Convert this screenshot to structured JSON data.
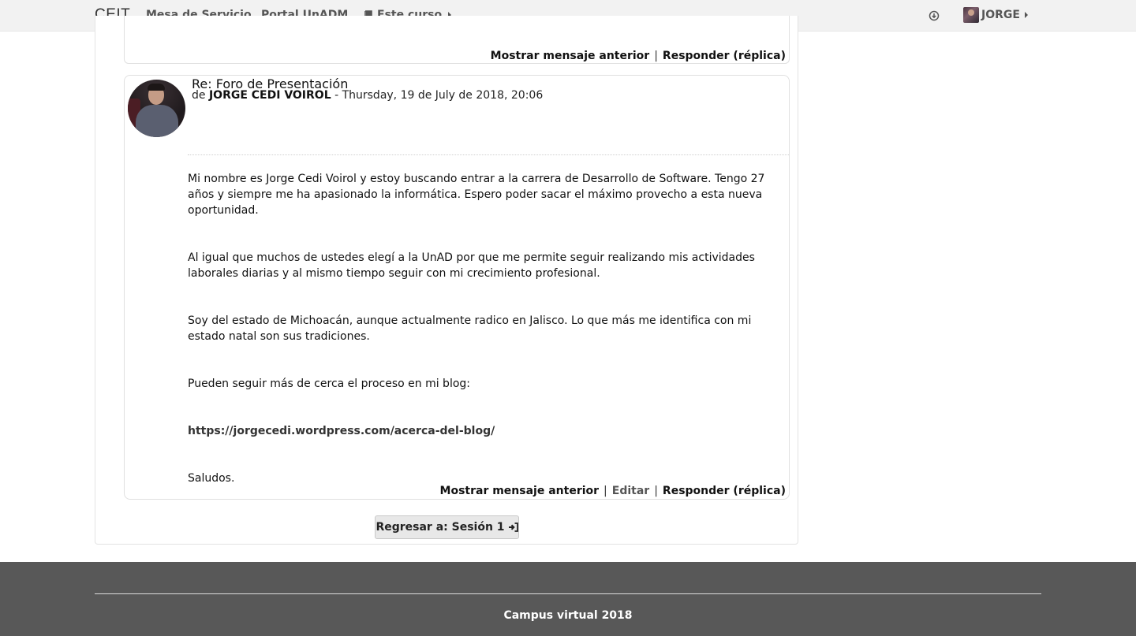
{
  "navbar": {
    "brand": "CEIT",
    "links": {
      "mesa": "Mesa de Servicio",
      "portal": "Portal UnADM",
      "curso": "Este curso"
    },
    "user_name": "JORGE"
  },
  "previous_post": {
    "commands": {
      "show_parent": "Mostrar mensaje anterior",
      "separator": "|",
      "reply": "Responder (réplica)"
    }
  },
  "post": {
    "subject": "Re: Foro de Presentación",
    "author_prefix": "de",
    "author_name": "JORGE CEDI VOIROL",
    "date": "- Thursday, 19 de July de 2018, 20:06",
    "paragraphs": [
      "Mi nombre es Jorge Cedi Voirol y estoy buscando entrar a la carrera de Desarrollo de Software. Tengo 27 años y siempre me ha apasionado la informática. Espero poder sacar el máximo provecho a esta nueva oportunidad.",
      "Al igual que muchos de ustedes elegí a la UnAD por que me permite seguir realizando mis actividades laborales diarias y al mismo tiempo seguir con mi crecimiento profesional.",
      "Soy del estado de Michoacán, aunque actualmente radico en Jalisco. Lo que más me identifica con mi estado natal son sus tradiciones.",
      "Pueden seguir más de cerca el proceso en mi blog:"
    ],
    "blog_link": "https://jorgecedi.wordpress.com/acerca-del-blog/",
    "closing": "Saludos.",
    "commands": {
      "show_parent": "Mostrar mensaje anterior",
      "separator": "|",
      "edit": "Editar",
      "reply": "Responder (réplica)"
    }
  },
  "back_button": {
    "label": "Regresar a: Sesión 1"
  },
  "footer": {
    "text": "Campus virtual 2018"
  },
  "icons": {
    "book": "book-icon",
    "download": "download-icon",
    "signin": "sign-in-icon",
    "caret": "caret-right-icon"
  }
}
